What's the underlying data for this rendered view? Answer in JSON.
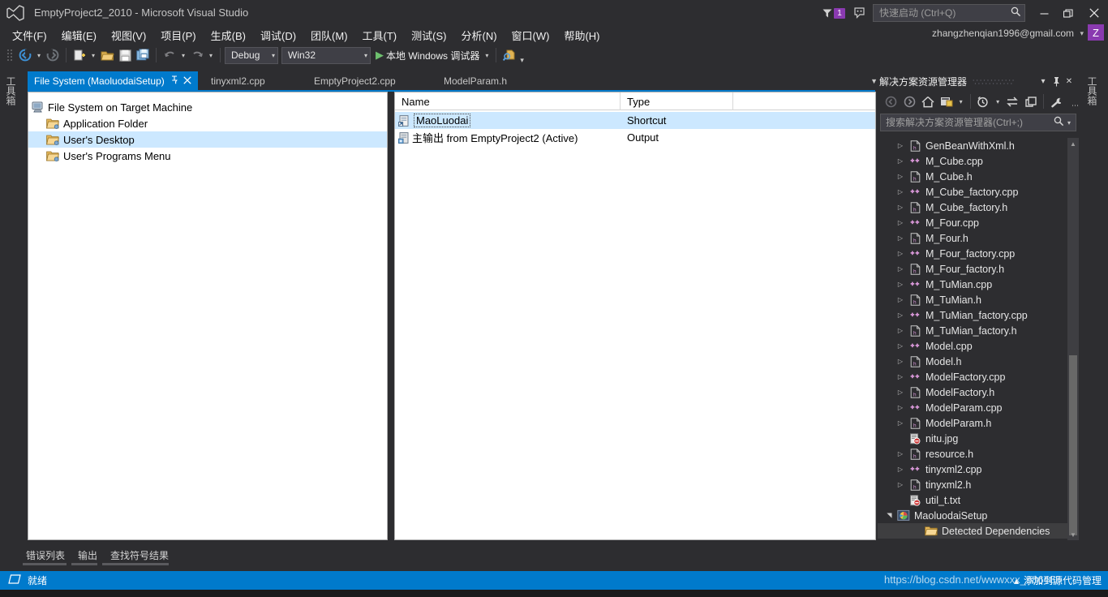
{
  "window": {
    "title": "EmptyProject2_2010 - Microsoft Visual Studio",
    "logo_icon": "visual-studio-logo",
    "minimize_icon": "–",
    "restore_icon": "❐",
    "close_icon": "✕",
    "notification_count": "1",
    "notification_icon": "flag-icon",
    "feedback_icon": "feedback-smiley-icon",
    "account_email": "zhangzhenqian1996@gmail.com",
    "account_initial": "Z",
    "account_caret": "▾"
  },
  "quick_launch": {
    "placeholder": "快速启动 (Ctrl+Q)",
    "value": "",
    "search_icon": "search-icon"
  },
  "menubar": [
    {
      "label": "文件(F)"
    },
    {
      "label": "编辑(E)"
    },
    {
      "label": "视图(V)"
    },
    {
      "label": "项目(P)"
    },
    {
      "label": "生成(B)"
    },
    {
      "label": "调试(D)"
    },
    {
      "label": "团队(M)"
    },
    {
      "label": "工具(T)"
    },
    {
      "label": "测试(S)"
    },
    {
      "label": "分析(N)"
    },
    {
      "label": "窗口(W)"
    },
    {
      "label": "帮助(H)"
    }
  ],
  "toolbar": {
    "nav_back_icon": "navigate-back-icon",
    "nav_forward_icon": "navigate-forward-icon",
    "new_project_icon": "new-project-icon",
    "open_file_icon": "open-file-icon",
    "save_icon": "save-icon",
    "save_all_icon": "save-all-icon",
    "undo_icon": "undo-icon",
    "redo_icon": "redo-icon",
    "config_combo": "Debug",
    "platform_combo": "Win32",
    "run_label": "本地 Windows 调试器",
    "run_icon": "play-icon",
    "find_in_files_icon": "find-in-files-icon",
    "overflow_icon": "toolbar-overflow-icon",
    "dropdown_caret": "▾"
  },
  "document_tabs": [
    {
      "label": "File System (MaoluodaiSetup)",
      "active": true,
      "pin_icon": "⇱",
      "close_icon": "✕"
    },
    {
      "label": "tinyxml2.cpp",
      "active": false
    },
    {
      "label": "EmptyProject2.cpp",
      "active": false
    },
    {
      "label": "ModelParam.h",
      "active": false
    }
  ],
  "tabstrip_overflow_icon": "tab-overflow-caret",
  "file_system_tree": [
    {
      "label": "File System on Target Machine",
      "icon": "target-machine-icon",
      "indent": 0,
      "selected": false
    },
    {
      "label": "Application Folder",
      "icon": "folder-app-icon",
      "indent": 1,
      "selected": false
    },
    {
      "label": "User's Desktop",
      "icon": "folder-desktop-icon",
      "indent": 1,
      "selected": true
    },
    {
      "label": "User's Programs Menu",
      "icon": "folder-programs-icon",
      "indent": 1,
      "selected": false
    }
  ],
  "file_list": {
    "columns": [
      "Name",
      "Type",
      ""
    ],
    "rows": [
      {
        "name": "MaoLuodai",
        "type": "Shortcut",
        "icon": "shortcut-icon",
        "selected": true,
        "focus_rect": true
      },
      {
        "name": "主输出 from EmptyProject2 (Active)",
        "type": "Output",
        "icon": "project-output-icon",
        "selected": false,
        "focus_rect": false
      }
    ]
  },
  "side_tabs": {
    "left": "工具箱",
    "right": "工具箱"
  },
  "solution_explorer": {
    "title": "解决方案资源管理器",
    "header_buttons": [
      {
        "icon": "chevron-down-icon",
        "glyph": "▾"
      },
      {
        "icon": "pin-icon",
        "glyph": "⇱"
      },
      {
        "icon": "close-icon",
        "glyph": "✕"
      }
    ],
    "toolbar_icons": [
      {
        "icon": "back-icon"
      },
      {
        "icon": "forward-icon"
      },
      {
        "icon": "home-icon"
      },
      {
        "icon": "properties-window-icon"
      },
      {
        "icon": "pending-changes-icon"
      },
      {
        "icon": "sync-with-active-document-icon"
      },
      {
        "icon": "collapse-all-icon"
      },
      {
        "icon": "wrench-properties-icon"
      }
    ],
    "search": {
      "placeholder": "搜索解决方案资源管理器(Ctrl+;)",
      "value": "",
      "search_icon": "search-icon",
      "caret": "▾"
    },
    "items": [
      {
        "label": "GenBeanWithXml.h",
        "icon": "header-file-icon",
        "expander": true,
        "indent": 1,
        "highlight": false
      },
      {
        "label": "M_Cube.cpp",
        "icon": "cpp-file-icon",
        "expander": true,
        "indent": 1,
        "highlight": false
      },
      {
        "label": "M_Cube.h",
        "icon": "header-file-icon",
        "expander": true,
        "indent": 1,
        "highlight": false
      },
      {
        "label": "M_Cube_factory.cpp",
        "icon": "cpp-file-icon",
        "expander": true,
        "indent": 1,
        "highlight": false
      },
      {
        "label": "M_Cube_factory.h",
        "icon": "header-file-icon",
        "expander": true,
        "indent": 1,
        "highlight": false
      },
      {
        "label": "M_Four.cpp",
        "icon": "cpp-file-icon",
        "expander": true,
        "indent": 1,
        "highlight": false
      },
      {
        "label": "M_Four.h",
        "icon": "header-file-icon",
        "expander": true,
        "indent": 1,
        "highlight": false
      },
      {
        "label": "M_Four_factory.cpp",
        "icon": "cpp-file-icon",
        "expander": true,
        "indent": 1,
        "highlight": false
      },
      {
        "label": "M_Four_factory.h",
        "icon": "header-file-icon",
        "expander": true,
        "indent": 1,
        "highlight": false
      },
      {
        "label": "M_TuMian.cpp",
        "icon": "cpp-file-icon",
        "expander": true,
        "indent": 1,
        "highlight": false
      },
      {
        "label": "M_TuMian.h",
        "icon": "header-file-icon",
        "expander": true,
        "indent": 1,
        "highlight": false
      },
      {
        "label": "M_TuMian_factory.cpp",
        "icon": "cpp-file-icon",
        "expander": true,
        "indent": 1,
        "highlight": false
      },
      {
        "label": "M_TuMian_factory.h",
        "icon": "header-file-icon",
        "expander": true,
        "indent": 1,
        "highlight": false
      },
      {
        "label": "Model.cpp",
        "icon": "cpp-file-icon",
        "expander": true,
        "indent": 1,
        "highlight": false
      },
      {
        "label": "Model.h",
        "icon": "header-file-icon",
        "expander": true,
        "indent": 1,
        "highlight": false
      },
      {
        "label": "ModelFactory.cpp",
        "icon": "cpp-file-icon",
        "expander": true,
        "indent": 1,
        "highlight": false
      },
      {
        "label": "ModelFactory.h",
        "icon": "header-file-icon",
        "expander": true,
        "indent": 1,
        "highlight": false
      },
      {
        "label": "ModelParam.cpp",
        "icon": "cpp-file-icon",
        "expander": true,
        "indent": 1,
        "highlight": false
      },
      {
        "label": "ModelParam.h",
        "icon": "header-file-icon",
        "expander": true,
        "indent": 1,
        "highlight": false
      },
      {
        "label": "nitu.jpg",
        "icon": "excluded-file-icon",
        "expander": false,
        "indent": 1,
        "highlight": false
      },
      {
        "label": "resource.h",
        "icon": "header-file-icon",
        "expander": true,
        "indent": 1,
        "highlight": false
      },
      {
        "label": "tinyxml2.cpp",
        "icon": "cpp-file-icon",
        "expander": true,
        "indent": 1,
        "highlight": false
      },
      {
        "label": "tinyxml2.h",
        "icon": "header-file-icon",
        "expander": true,
        "indent": 1,
        "highlight": false
      },
      {
        "label": "util_t.txt",
        "icon": "excluded-file-icon",
        "expander": false,
        "indent": 1,
        "highlight": false
      },
      {
        "label": "MaoluodaiSetup",
        "icon": "setup-project-icon",
        "expander": "expanded",
        "indent": 0,
        "highlight": false
      },
      {
        "label": "Detected Dependencies",
        "icon": "folder-icon",
        "expander": false,
        "indent": 2,
        "highlight": true
      }
    ],
    "scrollbar": {
      "up_arrow": "▲",
      "down_arrow": "▼"
    }
  },
  "bottom_tabs": [
    {
      "label": "错误列表"
    },
    {
      "label": "输出"
    },
    {
      "label": "查找符号结果"
    }
  ],
  "status_bar": {
    "icon": "ready-icon",
    "text": "就绪",
    "source_control_text": "添加到源代码管理",
    "source_control_caret": "▴"
  },
  "watermark": "https://blog.csdn.net/wwwxxx_986485",
  "colors": {
    "accent_blue": "#007acc",
    "chrome_dark": "#2d2d30",
    "panel_dark": "#252526",
    "selection_light_blue": "#cce8ff",
    "badge_purple": "#8a3ab0",
    "cpp_icon_purple": "#d696d6",
    "run_green": "#6ec06e"
  }
}
